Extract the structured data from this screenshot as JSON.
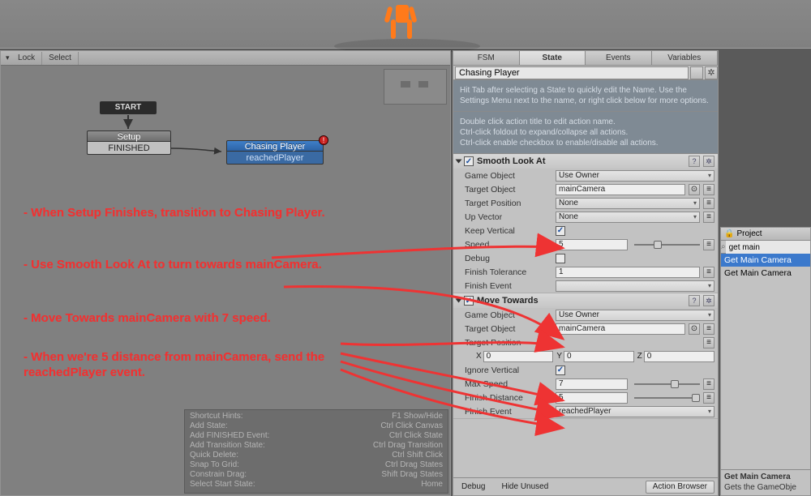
{
  "toolbar": {
    "lock": "Lock",
    "select": "Select"
  },
  "fsm": {
    "start_label": "START",
    "setup": {
      "title": "Setup",
      "event": "FINISHED"
    },
    "chasing": {
      "title": "Chasing Player",
      "event": "reachedPlayer"
    }
  },
  "annotations": {
    "a1": "- When Setup Finishes, transition to Chasing Player.",
    "a2": "- Use Smooth Look At to turn towards mainCamera.",
    "a3": "- Move Towards mainCamera with 7 speed.",
    "a4": "- When we're 5 distance from mainCamera, send the reachedPlayer event."
  },
  "hints": {
    "h1a": "Shortcut Hints:",
    "h1b": "F1 Show/Hide",
    "h2a": "Add State:",
    "h2b": "Ctrl Click Canvas",
    "h3a": "Add FINISHED Event:",
    "h3b": "Ctrl Click State",
    "h4a": "Add Transition State:",
    "h4b": "Ctrl Drag Transition",
    "h5a": "Quick Delete:",
    "h5b": "Ctrl Shift Click",
    "h6a": "Snap To Grid:",
    "h6b": "Ctrl Drag States",
    "h7a": "Constrain Drag:",
    "h7b": "Shift Drag States",
    "h8a": "Select Start State:",
    "h8b": "Home"
  },
  "tabs": {
    "fsm": "FSM",
    "state": "State",
    "events": "Events",
    "variables": "Variables"
  },
  "state_name": "Chasing Player",
  "help": {
    "l1": "Hit Tab after selecting a State to quickly edit the Name. Use the Settings Menu next to the name, or right click below for more options.",
    "l2a": "Double click action title to edit action name.",
    "l2b": "Ctrl-click foldout to expand/collapse all actions.",
    "l2c": "Ctrl-click enable checkbox to enable/disable all actions."
  },
  "look": {
    "title": "Smooth Look At",
    "game_object_l": "Game Object",
    "game_object_v": "Use Owner",
    "target_object_l": "Target Object",
    "target_object_v": "mainCamera",
    "target_position_l": "Target Position",
    "target_position_v": "None",
    "up_vector_l": "Up Vector",
    "up_vector_v": "None",
    "keep_vertical_l": "Keep Vertical",
    "speed_l": "Speed",
    "speed_v": "5",
    "debug_l": "Debug",
    "finish_tol_l": "Finish Tolerance",
    "finish_tol_v": "1",
    "finish_event_l": "Finish Event",
    "finish_event_v": ""
  },
  "move": {
    "title": "Move Towards",
    "game_object_l": "Game Object",
    "game_object_v": "Use Owner",
    "target_object_l": "Target Object",
    "target_object_v": "mainCamera",
    "target_position_l": "Target Position",
    "x_l": "X",
    "x_v": "0",
    "y_l": "Y",
    "y_v": "0",
    "z_l": "Z",
    "z_v": "0",
    "ignore_vertical_l": "Ignore Vertical",
    "max_speed_l": "Max Speed",
    "max_speed_v": "7",
    "finish_distance_l": "Finish Distance",
    "finish_distance_v": "5",
    "finish_event_l": "Finish Event",
    "finish_event_v": "reachedPlayer"
  },
  "bottom": {
    "debug": "Debug",
    "hide_unused": "Hide Unused",
    "action_browser": "Action Browser"
  },
  "project": {
    "title": "Project",
    "search": "get main",
    "item1": "Get Main Camera",
    "item2": "Get Main Camera",
    "foot1": "Get Main Camera",
    "foot2": "Gets the GameObje"
  }
}
